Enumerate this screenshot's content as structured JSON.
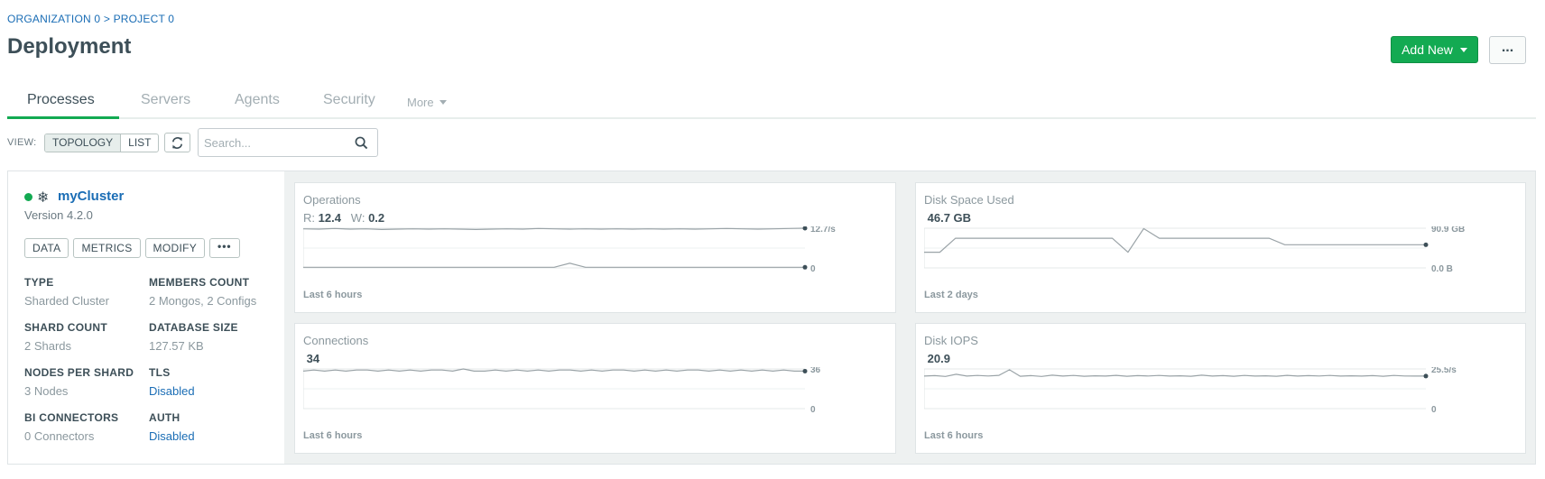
{
  "breadcrumb": {
    "org": "ORGANIZATION 0",
    "sep": ">",
    "project": "PROJECT 0"
  },
  "page_title": "Deployment",
  "header": {
    "add_new_label": "Add New",
    "more_label": "..."
  },
  "tabs": [
    {
      "label": "Processes",
      "active": true
    },
    {
      "label": "Servers"
    },
    {
      "label": "Agents"
    },
    {
      "label": "Security"
    }
  ],
  "tabs_more": "More",
  "view": {
    "label": "VIEW:",
    "options": [
      "TOPOLOGY",
      "LIST"
    ],
    "selected": "TOPOLOGY"
  },
  "search": {
    "placeholder": "Search...",
    "value": ""
  },
  "cluster": {
    "name": "myCluster",
    "status": "running",
    "version": "Version 4.2.0",
    "actions": [
      "DATA",
      "METRICS",
      "MODIFY",
      "•••"
    ],
    "properties": [
      {
        "label": "TYPE",
        "value": "Sharded Cluster"
      },
      {
        "label": "MEMBERS COUNT",
        "value": "2 Mongos, 2 Configs"
      },
      {
        "label": "SHARD COUNT",
        "value": "2 Shards"
      },
      {
        "label": "DATABASE SIZE",
        "value": "127.57 KB"
      },
      {
        "label": "NODES PER SHARD",
        "value": "3 Nodes"
      },
      {
        "label": "TLS",
        "value": "Disabled",
        "link": true
      },
      {
        "label": "BI CONNECTORS",
        "value": "0 Connectors"
      },
      {
        "label": "AUTH",
        "value": "Disabled",
        "link": true
      }
    ]
  },
  "metrics": {
    "operations": {
      "title": "Operations",
      "read_label": "R:",
      "read_value": "12.4",
      "write_label": "W:",
      "write_value": "0.2",
      "y_max_label": "12.7/s",
      "y_min_label": "0",
      "footer": "Last 6 hours",
      "series_read": [
        12.5,
        12.4,
        12.6,
        12.4,
        12.5,
        12.3,
        12.4,
        12.5,
        12.4,
        12.5,
        12.4,
        12.3,
        12.4,
        12.5,
        12.4,
        12.6,
        12.5,
        12.4,
        12.5,
        12.4,
        12.5,
        12.4,
        12.5,
        12.4,
        12.5,
        12.4,
        12.5,
        12.6,
        12.5,
        12.4,
        12.5,
        12.6,
        12.7
      ],
      "series_write": [
        0.2,
        0.2,
        0.2,
        0.2,
        0.2,
        0.2,
        0.2,
        0.2,
        0.2,
        0.2,
        0.2,
        0.2,
        0.2,
        0.2,
        0.2,
        0.2,
        0.2,
        1.5,
        0.2,
        0.2,
        0.2,
        0.2,
        0.2,
        0.2,
        0.2,
        0.2,
        0.2,
        0.2,
        0.2,
        0.2,
        0.2,
        0.2,
        0.2
      ],
      "y_max": 12.7
    },
    "disk_space": {
      "title": "Disk Space Used",
      "value": "46.7 GB",
      "y_max_label": "90.9 GB",
      "y_min_label": "0.0 B",
      "footer": "Last 2 days",
      "series": [
        36,
        36,
        68,
        68,
        68,
        68,
        68,
        68,
        68,
        68,
        68,
        68,
        68,
        36,
        90,
        68,
        68,
        68,
        68,
        68,
        68,
        68,
        68,
        53,
        53,
        53,
        53,
        53,
        53,
        53,
        53,
        53,
        53
      ],
      "y_max": 90.9
    },
    "connections": {
      "title": "Connections",
      "value": "34",
      "y_max_label": "36",
      "y_min_label": "0",
      "footer": "Last 6 hours",
      "series": [
        34,
        35,
        34,
        35,
        34,
        35,
        35,
        34,
        35,
        34,
        35,
        34,
        35,
        35,
        34,
        36,
        34,
        34,
        35,
        34,
        35,
        34,
        35,
        34,
        35,
        35,
        34,
        35,
        34,
        35,
        35,
        34,
        35,
        34,
        35,
        34,
        35,
        35,
        34,
        35,
        34,
        35,
        34,
        35,
        34,
        35,
        34,
        34
      ],
      "y_max": 36
    },
    "disk_iops": {
      "title": "Disk IOPS",
      "value": "20.9",
      "y_max_label": "25.5/s",
      "y_min_label": "0",
      "footer": "Last 6 hours",
      "series": [
        20.9,
        21.2,
        20.7,
        22.1,
        20.9,
        21.3,
        21.0,
        21.4,
        25.0,
        20.8,
        21.2,
        20.7,
        21.5,
        20.9,
        21.3,
        20.8,
        21.1,
        20.9,
        21.4,
        20.8,
        21.2,
        21.0,
        21.3,
        20.9,
        21.1,
        20.8,
        21.5,
        20.9,
        21.2,
        20.8,
        21.3,
        20.9,
        21.1,
        20.8,
        21.4,
        20.9,
        21.2,
        21.0,
        21.3,
        20.9,
        21.1,
        20.9,
        21.2,
        20.8,
        21.3,
        21.0,
        20.9,
        20.9
      ],
      "y_max": 25.5
    }
  }
}
